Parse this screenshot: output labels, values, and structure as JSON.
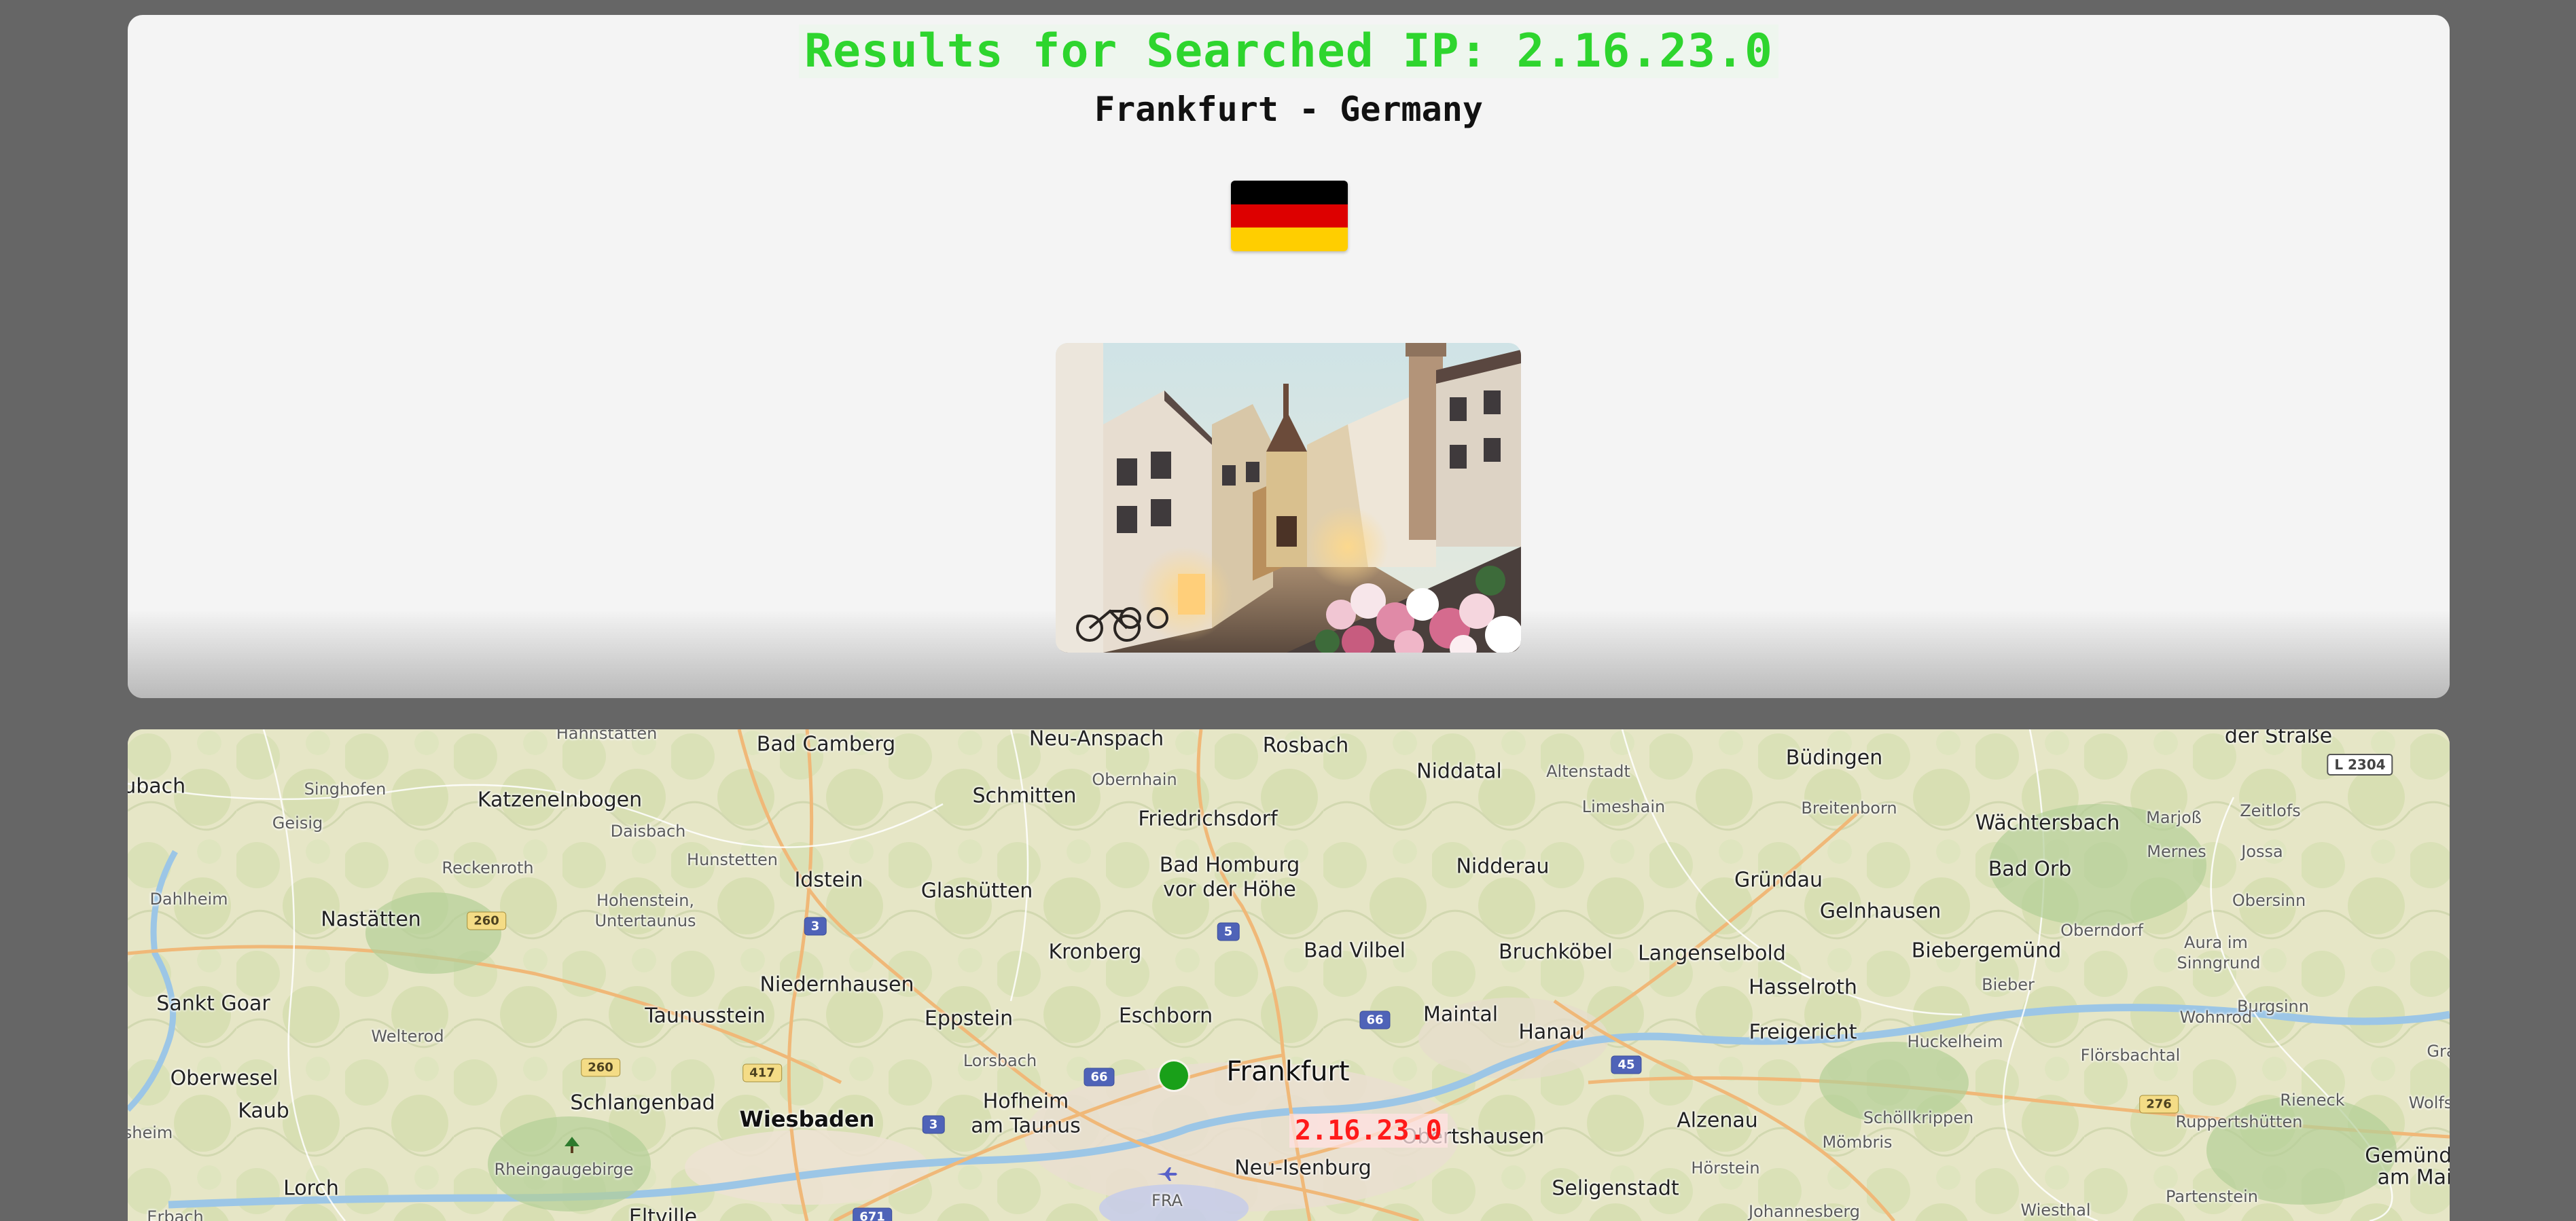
{
  "header": {
    "title": "Results for Searched IP: 2.16.23.0",
    "location": "Frankfurt - Germany"
  },
  "flag": {
    "icon": "germany-flag-icon",
    "colors": [
      "#000000",
      "#dd0000",
      "#ffce00"
    ]
  },
  "photo": {
    "icon": "city-street-photo"
  },
  "map": {
    "marker_label": "2.16.23.0",
    "marker_color": "#19a019",
    "labels": [
      {
        "name": "label-hahnstatten",
        "text": "Hahnstatten",
        "size": "small"
      },
      {
        "name": "label-bad-camberg",
        "text": "Bad Camberg",
        "size": "big"
      },
      {
        "name": "label-neu-anspach",
        "text": "Neu-Anspach",
        "size": "big"
      },
      {
        "name": "label-rosbach",
        "text": "Rosbach",
        "size": "big"
      },
      {
        "name": "label-der-strasse",
        "text": "der Straße",
        "size": "big"
      },
      {
        "name": "label-aubach",
        "text": "aubach",
        "size": "big"
      },
      {
        "name": "label-singhofen",
        "text": "Singhofen",
        "size": "small"
      },
      {
        "name": "label-katzenelnbogen",
        "text": "Katzenelnbogen",
        "size": "big"
      },
      {
        "name": "label-schmitten",
        "text": "Schmitten",
        "size": "big"
      },
      {
        "name": "label-obernhain",
        "text": "Obernhain",
        "size": "small"
      },
      {
        "name": "label-niddatal",
        "text": "Niddatal",
        "size": "big"
      },
      {
        "name": "label-altenstadt",
        "text": "Altenstadt",
        "size": "small"
      },
      {
        "name": "label-budingen",
        "text": "Büdingen",
        "size": "big"
      },
      {
        "name": "label-geisig",
        "text": "Geisig",
        "size": "small"
      },
      {
        "name": "label-daisbach",
        "text": "Daisbach",
        "size": "small"
      },
      {
        "name": "label-friedrichsdorf",
        "text": "Friedrichsdorf",
        "size": "big"
      },
      {
        "name": "label-limeshain",
        "text": "Limeshain",
        "size": "small"
      },
      {
        "name": "label-breitenborn",
        "text": "Breitenborn",
        "size": "small"
      },
      {
        "name": "label-wachtersbach",
        "text": "Wächtersbach",
        "size": "big"
      },
      {
        "name": "label-marjoss",
        "text": "Marjoß",
        "size": "small"
      },
      {
        "name": "label-zeitlofs",
        "text": "Zeitlofs",
        "size": "small"
      },
      {
        "name": "label-reckenroth",
        "text": "Reckenroth",
        "size": "small"
      },
      {
        "name": "label-hunstetten",
        "text": "Hunstetten",
        "size": "small"
      },
      {
        "name": "label-bad-homburg",
        "text": "Bad Homburg",
        "size": "big"
      },
      {
        "name": "label-nidderau",
        "text": "Nidderau",
        "size": "big"
      },
      {
        "name": "label-mernes",
        "text": "Mernes",
        "size": "small"
      },
      {
        "name": "label-jossa",
        "text": "Jossa",
        "size": "small"
      },
      {
        "name": "label-idstein",
        "text": "Idstein",
        "size": "big"
      },
      {
        "name": "label-grundau",
        "text": "Gründau",
        "size": "big"
      },
      {
        "name": "label-bad-orb",
        "text": "Bad Orb",
        "size": "big"
      },
      {
        "name": "label-dahlheim",
        "text": "Dahlheim",
        "size": "small"
      },
      {
        "name": "label-hohenstein",
        "text": "Hohenstein,",
        "size": "small"
      },
      {
        "name": "label-vor-der-hohe",
        "text": "vor der Höhe",
        "size": "big"
      },
      {
        "name": "label-glashutten",
        "text": "Glashütten",
        "size": "big"
      },
      {
        "name": "label-obersinn",
        "text": "Obersinn",
        "size": "small"
      },
      {
        "name": "label-gelnhausen",
        "text": "Gelnhausen",
        "size": "big"
      },
      {
        "name": "label-untertaunus",
        "text": "Untertaunus",
        "size": "small"
      },
      {
        "name": "label-nastatten",
        "text": "Nastätten",
        "size": "big"
      },
      {
        "name": "label-oberndorf",
        "text": "Oberndorf",
        "size": "small"
      },
      {
        "name": "label-aura",
        "text": "Aura im",
        "size": "small"
      },
      {
        "name": "label-bad-vilbel",
        "text": "Bad Vilbel",
        "size": "big"
      },
      {
        "name": "label-kronberg",
        "text": "Kronberg",
        "size": "big"
      },
      {
        "name": "label-bruchkobel",
        "text": "Bruchköbel",
        "size": "big"
      },
      {
        "name": "label-langenselbold",
        "text": "Langenselbold",
        "size": "big"
      },
      {
        "name": "label-biebergemund",
        "text": "Biebergemünd",
        "size": "big"
      },
      {
        "name": "label-sinngrund",
        "text": "Sinngrund",
        "size": "small"
      },
      {
        "name": "label-niedernhausen",
        "text": "Niedernhausen",
        "size": "big"
      },
      {
        "name": "label-bieber",
        "text": "Bieber",
        "size": "small"
      },
      {
        "name": "label-hasselroth",
        "text": "Hasselroth",
        "size": "big"
      },
      {
        "name": "label-sankt-goar",
        "text": "Sankt Goar",
        "size": "big"
      },
      {
        "name": "label-burgsinn",
        "text": "Burgsinn",
        "size": "small"
      },
      {
        "name": "label-taunusstein",
        "text": "Taunusstein",
        "size": "big"
      },
      {
        "name": "label-eppstein",
        "text": "Eppstein",
        "size": "big"
      },
      {
        "name": "label-eschborn",
        "text": "Eschborn",
        "size": "big"
      },
      {
        "name": "label-maintal",
        "text": "Maintal",
        "size": "big"
      },
      {
        "name": "label-wohnrod",
        "text": "Wohnrod",
        "size": "small"
      },
      {
        "name": "label-welterod",
        "text": "Welterod",
        "size": "small"
      },
      {
        "name": "label-hanau",
        "text": "Hanau",
        "size": "big"
      },
      {
        "name": "label-freigericht",
        "text": "Freigericht",
        "size": "big"
      },
      {
        "name": "label-huckelheim",
        "text": "Huckelheim",
        "size": "small"
      },
      {
        "name": "label-lorsbach",
        "text": "Lorsbach",
        "size": "small"
      },
      {
        "name": "label-florsbachtal",
        "text": "Flörsbachtal",
        "size": "small"
      },
      {
        "name": "label-gra",
        "text": "Gra",
        "size": "small"
      },
      {
        "name": "label-oberwesel",
        "text": "Oberwesel",
        "size": "big"
      },
      {
        "name": "label-frankfurt",
        "text": "Frankfurt",
        "size": "major"
      },
      {
        "name": "label-schlangenbad",
        "text": "Schlangenbad",
        "size": "big"
      },
      {
        "name": "label-hofheim",
        "text": "Hofheim",
        "size": "big"
      },
      {
        "name": "label-rieneck",
        "text": "Rieneck",
        "size": "small"
      },
      {
        "name": "label-wolfs",
        "text": "Wolfs",
        "size": "small"
      },
      {
        "name": "label-kaub",
        "text": "Kaub",
        "size": "big"
      },
      {
        "name": "label-wiesbaden",
        "text": "Wiesbaden",
        "size": "wies"
      },
      {
        "name": "label-alzenau",
        "text": "Alzenau",
        "size": "big"
      },
      {
        "name": "label-schollkrippen",
        "text": "Schöllkrippen",
        "size": "small"
      },
      {
        "name": "label-ruppertshutten",
        "text": "Ruppertshütten",
        "size": "small"
      },
      {
        "name": "label-am-taunus",
        "text": "am Taunus",
        "size": "big"
      },
      {
        "name": "label-sheim",
        "text": "sheim",
        "size": "small"
      },
      {
        "name": "label-obertshausen",
        "text": "Obertshausen",
        "size": "big"
      },
      {
        "name": "label-mombris",
        "text": "Mömbris",
        "size": "small"
      },
      {
        "name": "label-rheingaugebirge",
        "text": "Rheingaugebirge",
        "size": "small"
      },
      {
        "name": "label-gemunden",
        "text": "Gemünden",
        "size": "big"
      },
      {
        "name": "label-horstein",
        "text": "Hörstein",
        "size": "small"
      },
      {
        "name": "label-am-main",
        "text": "am Main",
        "size": "big"
      },
      {
        "name": "label-neu-isenburg",
        "text": "Neu-Isenburg",
        "size": "big"
      },
      {
        "name": "label-lorch",
        "text": "Lorch",
        "size": "big"
      },
      {
        "name": "label-seligenstadt",
        "text": "Seligenstadt",
        "size": "big"
      },
      {
        "name": "label-partenstein",
        "text": "Partenstein",
        "size": "small"
      },
      {
        "name": "label-fra",
        "text": "FRA",
        "size": "small"
      },
      {
        "name": "label-johannesberg",
        "text": "Johannesberg",
        "size": "small"
      },
      {
        "name": "label-wiesthal",
        "text": "Wiesthal",
        "size": "small"
      },
      {
        "name": "label-erbach",
        "text": "Erbach",
        "size": "small"
      },
      {
        "name": "label-eltville",
        "text": "Eltville",
        "size": "big"
      }
    ],
    "shields": [
      {
        "name": "shield-l2304",
        "text": "L 2304",
        "style": "white"
      },
      {
        "name": "shield-260-a",
        "text": "260",
        "style": "yellow"
      },
      {
        "name": "shield-a3-a",
        "text": "3",
        "style": "blue"
      },
      {
        "name": "shield-a5",
        "text": "5",
        "style": "blue"
      },
      {
        "name": "shield-a66-a",
        "text": "66",
        "style": "blue"
      },
      {
        "name": "shield-260-b",
        "text": "260",
        "style": "yellow"
      },
      {
        "name": "shield-417",
        "text": "417",
        "style": "yellow"
      },
      {
        "name": "shield-a66-b",
        "text": "66",
        "style": "blue"
      },
      {
        "name": "shield-a45",
        "text": "45",
        "style": "blue"
      },
      {
        "name": "shield-276",
        "text": "276",
        "style": "yellow"
      },
      {
        "name": "shield-a3-b",
        "text": "3",
        "style": "blue"
      },
      {
        "name": "shield-a671",
        "text": "671",
        "style": "blue"
      }
    ]
  }
}
